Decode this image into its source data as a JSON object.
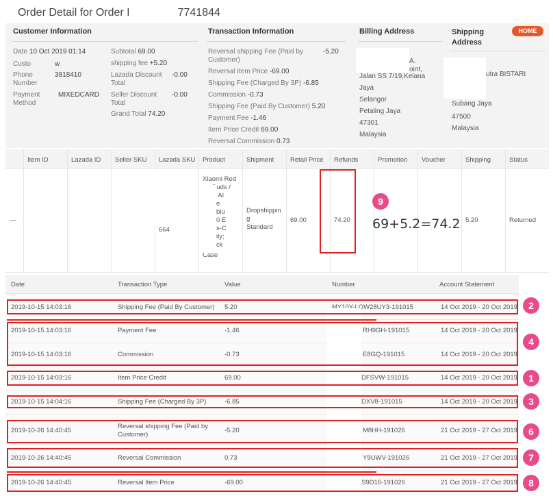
{
  "page": {
    "title": "Order Detail for Order I",
    "order_suffix": "7741844"
  },
  "customer": {
    "title": "Customer Information",
    "date_label": "Date",
    "date_value": "10 Oct 2019 01:14",
    "name_label": "Custo",
    "name_value": "w",
    "phone_label": "Phone Number",
    "phone_value": "3818410",
    "payment_label": "Payment Method",
    "payment_value": "MIXEDCARD",
    "subtotal_label": "Subtotal",
    "subtotal_value": "69.00",
    "shipping_label": "shipping fee",
    "shipping_value": "+5.20",
    "lazada_discount_label": "Lazada Discount Total",
    "lazada_discount_value": "-0.00",
    "seller_discount_label": "Seller Discount Total",
    "seller_discount_value": "-0.00",
    "grand_total_label": "Grand Total",
    "grand_total_value": "74.20"
  },
  "transaction": {
    "title": "Transaction Information",
    "lines": [
      {
        "label": "Reversal shipping Fee (Paid by Customer)",
        "value": "-5.20"
      },
      {
        "label": "Reversal Item Price",
        "value": "-69.00"
      },
      {
        "label": "Shipping Fee (Charged By 3P)",
        "value": "-6.85"
      },
      {
        "label": "Commission",
        "value": "-0.73"
      },
      {
        "label": "Shipping Fee (Paid By Customer)",
        "value": "5.20"
      },
      {
        "label": "Payment Fee",
        "value": "-1.46"
      },
      {
        "label": "Item Price Credit",
        "value": "69.00"
      },
      {
        "label": "Reversal Commission",
        "value": "0.73"
      }
    ]
  },
  "billing": {
    "title": "Billing Address",
    "lines": [
      "A.",
      "oint,",
      "Jalan SS 7/19,Kelana",
      "Jaya",
      "Selangor",
      "Petaling Jaya",
      "47301",
      "Malaysia"
    ]
  },
  "shipping_address": {
    "title": "Shipping Address",
    "badge": "HOME",
    "lines": [
      "utra BISTARI",
      "Subang Jaya",
      "47500",
      "Malaysia"
    ]
  },
  "items_table": {
    "headers": [
      "Item ID",
      "Lazada ID",
      "Seller SKU",
      "Lazada SKU",
      "Product",
      "Shipment",
      "Retail Price",
      "Refunds",
      "Promotion",
      "Voucher",
      "Shipping",
      "Status"
    ],
    "row": {
      "item_id": "—",
      "lazada_sku": "664",
      "product_lines": [
        "Xiaomi Red",
        "Buds /",
        "i AI",
        "e",
        "blu",
        "0 E",
        "s-C",
        "ily;",
        "ck",
        "Case"
      ],
      "shipment_lines": [
        "Dropshippin",
        "g",
        "Standard"
      ],
      "retail_price": "69.00",
      "refunds": "74.20",
      "shipping": "5.20",
      "status": "Returned"
    },
    "annotation_number": "9",
    "formula": "69+5.2=74.2"
  },
  "tx_table": {
    "headers": [
      "Date",
      "Transaction Type",
      "Value",
      "Number",
      "Account Statement"
    ],
    "rows": [
      {
        "date": "2019-10-15 14:03:16",
        "type": "Shipping Fee (Paid By Customer)",
        "value": "5.20",
        "number": "MY10Y-LOW28UY3-191015",
        "statement": "14 Oct 2019 - 20 Oct 2019"
      },
      {
        "date": "2019-10-15 14:03:16",
        "type": "Payment Fee",
        "value": "-1.46",
        "number": "RH9GH-191015",
        "statement": "14 Oct 2019 - 20 Oct 2019"
      },
      {
        "date": "2019-10-15 14:03:16",
        "type": "Commission",
        "value": "-0.73",
        "number": "E8GQ-191015",
        "statement": "14 Oct 2019 - 20 Oct 2019"
      },
      {
        "date": "2019-10-15 14:03:16",
        "type": "Item Price Credit",
        "value": "69.00",
        "number": "DFSVW-191015",
        "statement": "14 Oct 2019 - 20 Oct 2019"
      },
      {
        "date": "2019-10-15 14:04:16",
        "type": "Shipping Fee (Charged By 3P)",
        "value": "-6.85",
        "number": "DXV8-191015",
        "statement": "14 Oct 2019 - 20 Oct 2019"
      },
      {
        "date": "2019-10-26 14:40:45",
        "type": "Reversal shipping Fee (Paid by Customer)",
        "value": "-5.20",
        "number": "M8HH-191026",
        "statement": "21 Oct 2019 - 27 Oct 2019"
      },
      {
        "date": "2019-10-26 14:40:45",
        "type": "Reversal Commission",
        "value": "0.73",
        "number": "Y9UWV-191026",
        "statement": "21 Oct 2019 - 27 Oct 2019"
      },
      {
        "date": "2019-10-26 14:40:45",
        "type": "Reversal Item Price",
        "value": "-69.00",
        "number": "S9D16-191026",
        "statement": "21 Oct 2019 - 27 Oct 2019"
      }
    ],
    "annotations": [
      "2",
      "4",
      "1",
      "3",
      "6",
      "7",
      "8"
    ]
  },
  "colors": {
    "annotation_red": "#e02020",
    "circle_pink": "#e84a8a",
    "home_badge": "#e8562a",
    "panel_bg": "#f3f3f3"
  }
}
